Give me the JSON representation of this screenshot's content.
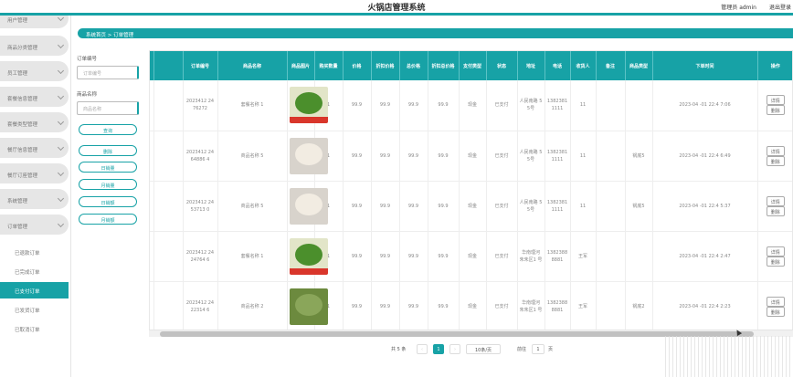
{
  "header": {
    "title": "火锅店管理系统",
    "admin": "管理员 admin",
    "logout": "退出登录"
  },
  "sidebar": {
    "menus": [
      {
        "label": "用户管理"
      },
      {
        "label": "商品分类管理"
      },
      {
        "label": "员工管理"
      },
      {
        "label": "套餐信息管理"
      },
      {
        "label": "套餐类型管理"
      },
      {
        "label": "餐厅信息管理"
      },
      {
        "label": "餐厅订座管理"
      },
      {
        "label": "系统管理"
      },
      {
        "label": "订单管理"
      }
    ],
    "subs": [
      {
        "label": "已退款订单"
      },
      {
        "label": "已完成订单"
      },
      {
        "label": "已支付订单"
      },
      {
        "label": "已发货订单"
      },
      {
        "label": "已取消订单"
      }
    ]
  },
  "breadcrumb": "系统首页 > 订单管理",
  "filter": {
    "order_label": "订单编号",
    "order_placeholder": "订单编号",
    "product_label": "商品名称",
    "product_placeholder": "商品名称",
    "search_btn": "查询",
    "delete_btn": "删除",
    "stats": [
      "日销量",
      "月销量",
      "日销额",
      "月销额"
    ]
  },
  "table": {
    "headers": [
      "订单编号",
      "商品名称",
      "商品图片",
      "购买数量",
      "价格",
      "折扣价格",
      "总价格",
      "折扣总价格",
      "支付类型",
      "状态",
      "地址",
      "电话",
      "收货人",
      "备注",
      "商品类型",
      "下单时间",
      "操作"
    ],
    "rows": [
      {
        "order_no": "2023412 2476272",
        "product": "套餐名称 1",
        "qty": "1",
        "price": "99.9",
        "discount_price": "99.9",
        "total": "99.9",
        "discount_total": "99.9",
        "pay": "现金",
        "status": "已支付",
        "addr": "人民南路 55号",
        "phone": "1382381 1111",
        "receiver": "11",
        "note": "",
        "type": "",
        "time": "2023-04 -01 22:4 7:06",
        "colors": [
          "#e2e5c8",
          "#4b8f2c"
        ]
      },
      {
        "order_no": "2023412 2464886 4",
        "product": "商品名称 5",
        "qty": "1",
        "price": "99.9",
        "discount_price": "99.9",
        "total": "99.9",
        "discount_total": "99.9",
        "pay": "现金",
        "status": "已支付",
        "addr": "人民南路 55号",
        "phone": "1382381 1111",
        "receiver": "11",
        "note": "",
        "type": "锅底5",
        "time": "2023-04 -01 22:4 6:49",
        "colors": [
          "#d8d3cc",
          "#f2ece2"
        ]
      },
      {
        "order_no": "2023412 2453713 0",
        "product": "商品名称 5",
        "qty": "1",
        "price": "99.9",
        "discount_price": "99.9",
        "total": "99.9",
        "discount_total": "99.9",
        "pay": "现金",
        "status": "已支付",
        "addr": "人民南路 55号",
        "phone": "1382381 1111",
        "receiver": "11",
        "note": "",
        "type": "锅底5",
        "time": "2023-04 -01 22:4 5:37",
        "colors": [
          "#d8d3cc",
          "#f2ece2"
        ]
      },
      {
        "order_no": "2023412 2424764 6",
        "product": "套餐名称 1",
        "qty": "1",
        "price": "99.9",
        "discount_price": "99.9",
        "total": "99.9",
        "discount_total": "99.9",
        "pay": "现金",
        "status": "已支付",
        "addr": "华南理河 朱朱区1 号",
        "phone": "1382388 8881",
        "receiver": "王军",
        "note": "",
        "type": "",
        "time": "2023-04 -01 22:4 2:47",
        "colors": [
          "#e2e5c8",
          "#4b8f2c"
        ]
      },
      {
        "order_no": "2023412 2422314 6",
        "product": "商品名称 2",
        "qty": "1",
        "price": "99.9",
        "discount_price": "99.9",
        "total": "99.9",
        "discount_total": "99.9",
        "pay": "现金",
        "status": "已支付",
        "addr": "华南理河 朱朱区1 号",
        "phone": "1382388 8881",
        "receiver": "王军",
        "note": "",
        "type": "锅底2",
        "time": "2023-04 -01 22:4 2:23",
        "colors": [
          "#6c8a3e",
          "#8aa65a"
        ]
      }
    ],
    "ops": {
      "detail": "详情",
      "delete": "删除"
    }
  },
  "pager": {
    "total": "共 5 条",
    "prev": "‹",
    "page": "1",
    "next": "›",
    "size": "10条/页",
    "goto": "前往",
    "goto_page": "1",
    "goto_unit": "页"
  }
}
